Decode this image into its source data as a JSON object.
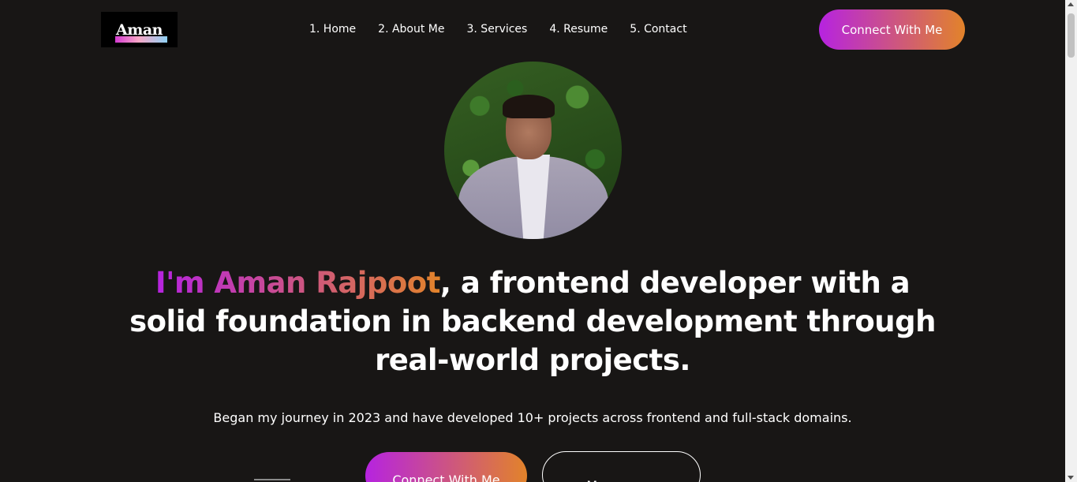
{
  "header": {
    "logo_text": "Aman",
    "nav": [
      {
        "label": "1. Home"
      },
      {
        "label": "2. About Me"
      },
      {
        "label": "3. Services"
      },
      {
        "label": "4. Resume"
      },
      {
        "label": "5. Contact"
      }
    ],
    "cta_label": "Connect With Me"
  },
  "hero": {
    "name_prefix": "I'm Aman Rajpoot",
    "headline_rest": ", a frontend developer with a solid foundation in backend development through real-world projects.",
    "subtitle": "Began my journey in 2023 and have developed 10+ projects across frontend and full-stack domains.",
    "primary_button": "Connect With Me",
    "secondary_button": "My resume"
  },
  "colors": {
    "background": "#181615",
    "gradient_start": "#b623e0",
    "gradient_end": "#e2832a"
  }
}
